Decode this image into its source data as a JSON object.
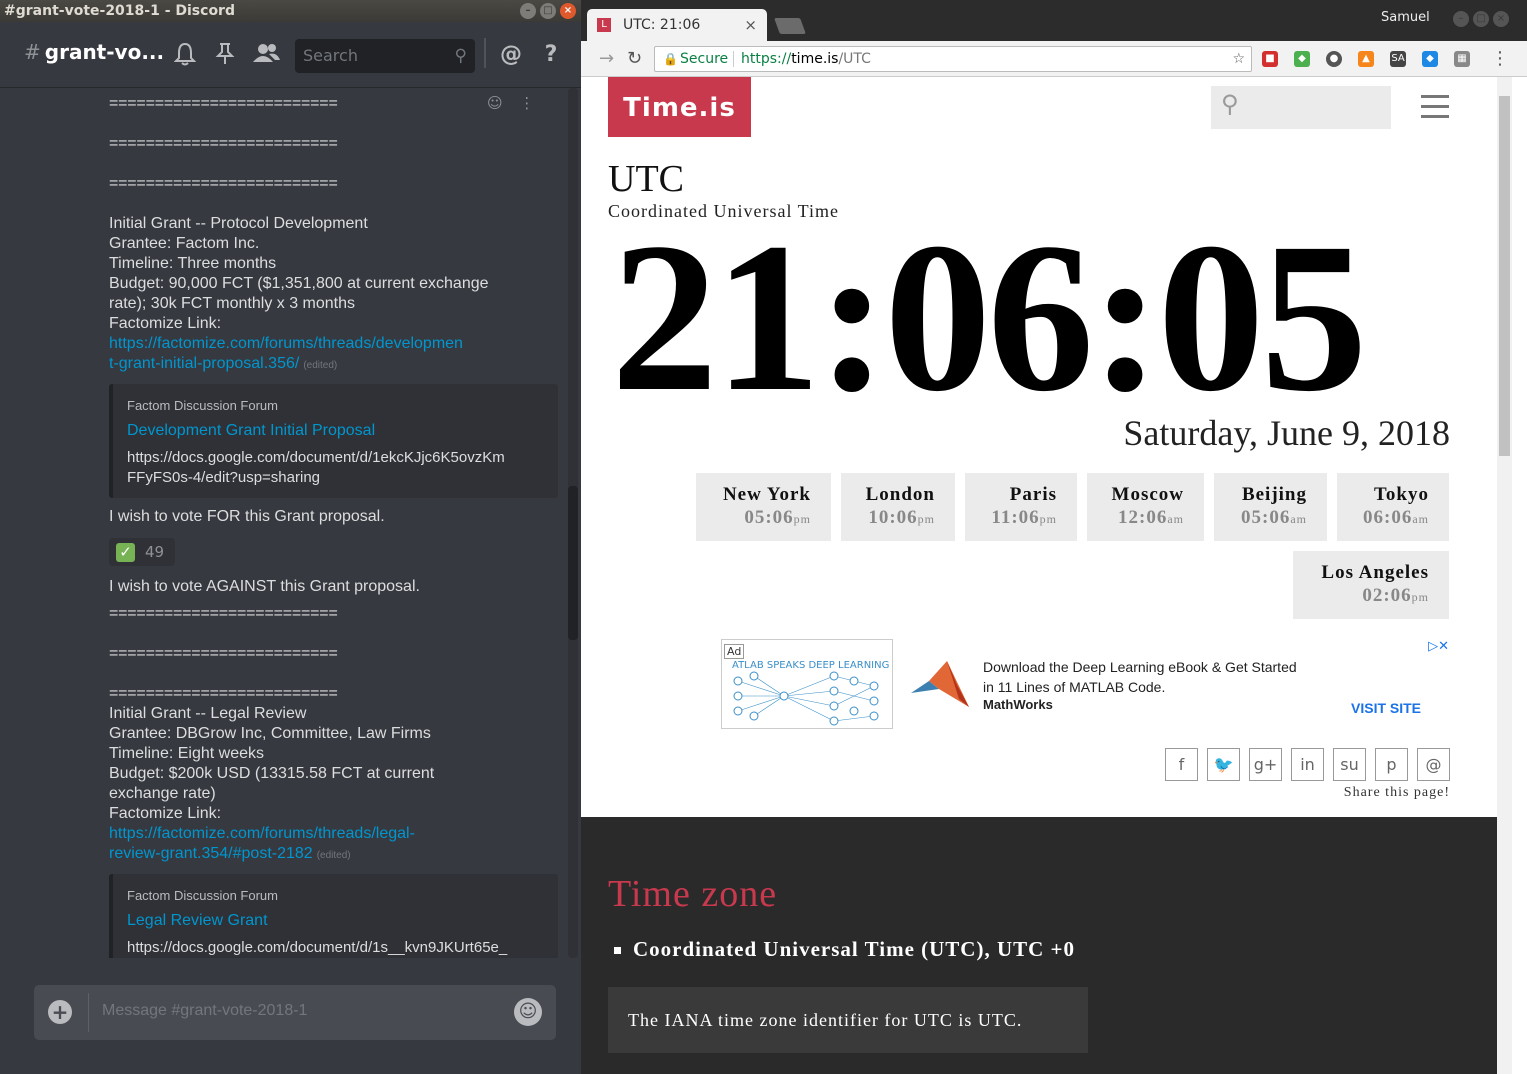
{
  "discord": {
    "window_title": "#grant-vote-2018-1 - Discord",
    "channel_name": "grant-vo...",
    "search_placeholder": "Search",
    "separator": "=========================",
    "messages": {
      "grant1_title": "Initial Grant -- Protocol Development",
      "grant1_grantee": "Grantee: Factom Inc.",
      "grant1_timeline": "Timeline: Three months",
      "grant1_budget_1": "Budget: 90,000 FCT ($1,351,800 at current exchange",
      "grant1_budget_2": "rate); 30k FCT monthly x 3 months",
      "grant1_link_label": "Factomize Link:",
      "grant1_link_1": "https://factomize.com/forums/threads/developmen",
      "grant1_link_2": "t-grant-initial-proposal.356/",
      "edited": "(edited)",
      "vote_for": "I wish to vote FOR this Grant proposal.",
      "vote_against": "I wish to vote AGAINST this Grant proposal.",
      "grant2_title": "Initial Grant -- Legal Review",
      "grant2_grantee": "Grantee: DBGrow Inc, Committee, Law Firms",
      "grant2_timeline": "Timeline: Eight weeks",
      "grant2_budget_1": "Budget: $200k USD (13315.58 FCT at current",
      "grant2_budget_2": "exchange rate)",
      "grant2_link_label": "Factomize Link:",
      "grant2_link_1": "https://factomize.com/forums/threads/legal-",
      "grant2_link_2": "review-grant.354/#post-2182"
    },
    "embed1": {
      "provider": "Factom Discussion Forum",
      "title": "Development Grant Initial Proposal",
      "desc": "https://docs.google.com/document/d/1ekcKJjc6K5ovzKm\nFFyFS0s-4/edit?usp=sharing"
    },
    "embed2": {
      "provider": "Factom Discussion Forum",
      "title": "Legal Review Grant",
      "desc": "https://docs.google.com/document/d/1s__kvn9JKUrt65e_"
    },
    "reaction_count": "49",
    "input_placeholder": "Message #grant-vote-2018-1"
  },
  "chrome": {
    "tab_title": "UTC: 21:06",
    "user": "Samuel",
    "secure_label": "Secure",
    "url_scheme": "https://",
    "url_host": "time.is",
    "url_path": "/UTC"
  },
  "timeis": {
    "logo": "Time.is",
    "zone": "UTC",
    "zone_full": "Coordinated Universal Time",
    "clock": "21:06:05",
    "date": "Saturday, June 9, 2018",
    "cities": [
      {
        "name": "New York",
        "time": "05:06",
        "ampm": "pm"
      },
      {
        "name": "London",
        "time": "10:06",
        "ampm": "pm"
      },
      {
        "name": "Paris",
        "time": "11:06",
        "ampm": "pm"
      },
      {
        "name": "Moscow",
        "time": "12:06",
        "ampm": "am"
      },
      {
        "name": "Beijing",
        "time": "05:06",
        "ampm": "am"
      },
      {
        "name": "Tokyo",
        "time": "06:06",
        "ampm": "am"
      },
      {
        "name": "Los Angeles",
        "time": "02:06",
        "ampm": "pm"
      }
    ],
    "ad": {
      "badge": "Ad",
      "image_text": "ATLAB SPEAKS DEEP LEARNING",
      "text": "Download the Deep Learning eBook & Get Started in 11 Lines of MATLAB Code.",
      "brand": "MathWorks",
      "cta": "VISIT SITE"
    },
    "share_label": "Share this page!",
    "share_icons": [
      "f",
      "🐦",
      "g+",
      "in",
      "su",
      "p",
      "@"
    ],
    "tz_heading": "Time zone",
    "tz_item": "Coordinated Universal Time (UTC), UTC +0",
    "iana": "The IANA time zone identifier for UTC is UTC.",
    "accent_color": "#c8394e"
  }
}
